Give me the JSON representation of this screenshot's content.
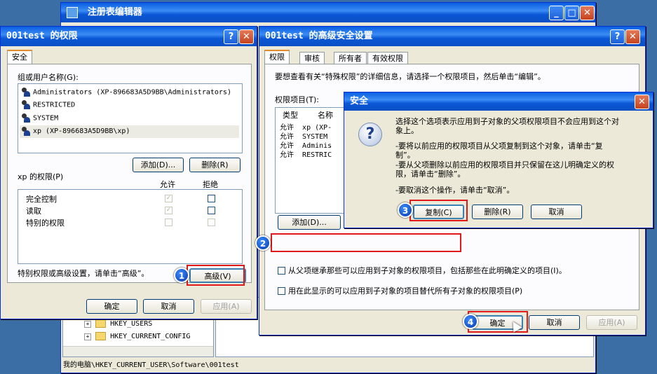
{
  "registry": {
    "title": "注册表编辑器",
    "tree_items": [
      "HKEY_USERS",
      "HKEY_CURRENT_CONFIG"
    ],
    "status": "我的电脑\\HKEY_CURRENT_USER\\Software\\001test"
  },
  "perm_dialog": {
    "title": "001test 的权限",
    "tab": "安全",
    "group_label": "组或用户名称(G):",
    "users": [
      "Administrators (XP-896683A5D9BB\\Administrators)",
      "RESTRICTED",
      "SYSTEM",
      "xp (XP-896683A5D9BB\\xp)"
    ],
    "add_button": "添加(D)...",
    "remove_button": "删除(R)",
    "perm_label": "xp 的权限(P)",
    "col_allow": "允许",
    "col_deny": "拒绝",
    "perms": [
      "完全控制",
      "读取",
      "特别的权限"
    ],
    "advanced_hint": "特别权限或高级设置，请单击“高级”。",
    "advanced_button": "高级(V)",
    "ok": "确定",
    "cancel": "取消",
    "apply": "应用(A)"
  },
  "adv_dialog": {
    "title": "001test 的高级安全设置",
    "tabs": [
      "权限",
      "审核",
      "所有者",
      "有效权限"
    ],
    "info": "要想查看有关“特殊权限”的详细信息，请选择一个权限项目，然后单击“编辑”。",
    "entries_label": "权限项目(T):",
    "col_type": "类型",
    "col_name": "名称",
    "rows": [
      {
        "type": "允许",
        "name": "xp (XP-"
      },
      {
        "type": "允许",
        "name": "SYSTEM"
      },
      {
        "type": "允许",
        "name": "Adminis"
      },
      {
        "type": "允许",
        "name": "RESTRIC"
      }
    ],
    "add_button": "添加(D)...",
    "inherit_label": "从父项继承那些可以应用到子对象的权限项目，",
    "inherit_suffix": "包括那些在此明确定义的项目(I)。",
    "replace_label": "用在此显示的可以应用到子对象的项目替代所有子对象的权限项目(P)",
    "ok": "确定",
    "cancel": "取消",
    "apply": "应用(A)"
  },
  "security_dialog": {
    "title": "安全",
    "line1": "选择这个选项表示应用到子对象的父项权限项目不会应用到这个对",
    "line2": "象上。",
    "line3": "-要将以前应用的权限项目从父项复制到这个对象，请单击“复",
    "line4": "制”。",
    "line5": "-要从父项删除以前应用的权限项目并只保留在这儿明确定义的权",
    "line6": "限，请单击“删除”。",
    "line7": "-要取消这个操作，请单击“取消”。",
    "copy_button": "复制(C)",
    "delete_button": "删除(R)",
    "cancel_button": "取消"
  },
  "steps": [
    "1",
    "2",
    "3",
    "4"
  ]
}
